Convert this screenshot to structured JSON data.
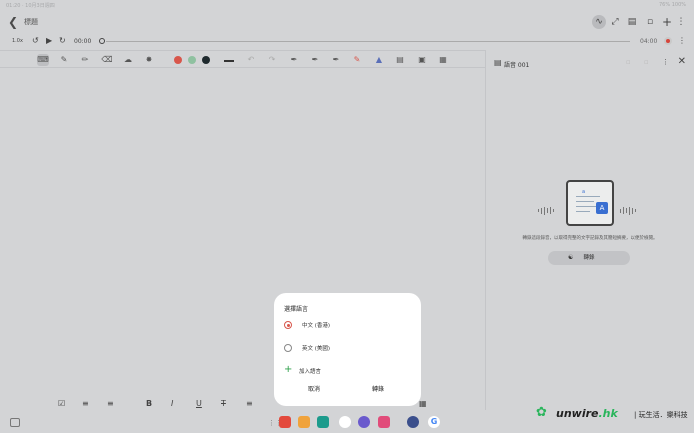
{
  "status": {
    "left": "01:20 · 10月3日週四",
    "right": "76% 100%"
  },
  "header": {
    "title": "標題",
    "icons": [
      "voice-wave-icon",
      "expand-icon",
      "book-icon",
      "page-icon",
      "add-icon",
      "more-icon"
    ]
  },
  "player": {
    "speed": "1.0x",
    "current": "00:00",
    "total": "04:00"
  },
  "toolbar": {
    "colors": [
      "#d8564b",
      "#8fc1a0",
      "#1f2a2e"
    ]
  },
  "panel": {
    "title": "語音 001",
    "description": "轉錄這段錄音，以取得完整的文字記錄及其簡短摘要，以便於檢閱。",
    "convert_label": "轉錄"
  },
  "dialog": {
    "title": "選擇語言",
    "options": [
      {
        "label": "中文 (香港)",
        "selected": true
      },
      {
        "label": "英文 (美國)",
        "selected": false
      }
    ],
    "add_label": "加入語言",
    "cancel": "取消",
    "confirm": "轉錄"
  },
  "dock": {
    "apps": [
      "#e3493c",
      "#f0a33c",
      "#1c9b8c",
      "#ffffff",
      "#6a5acd",
      "#e14c7a",
      "#3b4f8c"
    ]
  },
  "watermark": {
    "brand": "unwire",
    "suffix": ".hk",
    "tagline": "| 玩生活．樂科技"
  }
}
